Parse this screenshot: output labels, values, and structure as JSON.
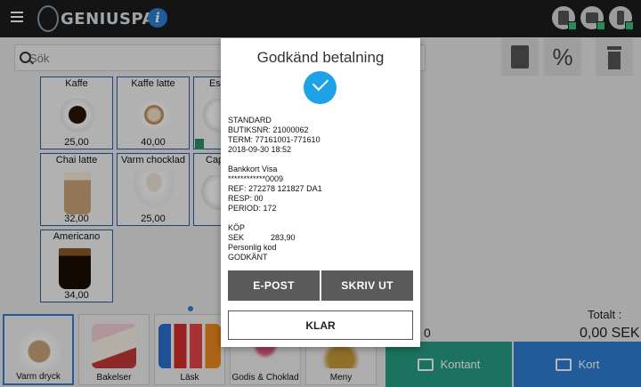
{
  "app": {
    "name": "GENIUSPAY",
    "menu_icon": "hamburger-icon",
    "info_icon": "info-icon"
  },
  "top_icons": [
    "bottle-icon",
    "printer-icon",
    "card-terminal-icon"
  ],
  "search": {
    "placeholder": "Sök"
  },
  "tools": [
    "calculator-icon",
    "percent-icon",
    "trash-icon"
  ],
  "products": [
    {
      "name": "Kaffe",
      "price": "25,00"
    },
    {
      "name": "Kaffe latte",
      "price": "40,00"
    },
    {
      "name": "Es",
      "price": ""
    },
    {
      "name": "Chai latte",
      "price": "32,00"
    },
    {
      "name": "Varm chocklad",
      "price": "25,00"
    },
    {
      "name": "Cap",
      "price": ""
    },
    {
      "name": "Americano",
      "price": "34,00"
    }
  ],
  "categories": [
    "Varm dryck",
    "Bakelser",
    "Läsk",
    "Godis & Choklad",
    "Meny"
  ],
  "totals": {
    "label": "Totalt :",
    "value": "0,00 SEK",
    "count": "0"
  },
  "pay": {
    "cash_label": "Kontant",
    "card_label": "Kort"
  },
  "colors": {
    "cash": "#26a084",
    "card": "#2f7fd6",
    "check": "#1ea2e6"
  },
  "dialog": {
    "title": "Godkänd betalning",
    "receipt_lines": [
      "STANDARD",
      "BUTIKSNR: 21000062",
      "TERM: 77161001-771610",
      "2018-09-30 18:52",
      "",
      "Bankkort Visa",
      "************0009",
      "REF: 272278 121827 DA1",
      "RESP: 00",
      "PERIOD: 172",
      "",
      "KÖP",
      "SEK            283,90",
      "Personlig kod",
      "GODKÄNT"
    ],
    "email_label": "E-POST",
    "print_label": "SKRIV UT",
    "done_label": "KLAR"
  }
}
